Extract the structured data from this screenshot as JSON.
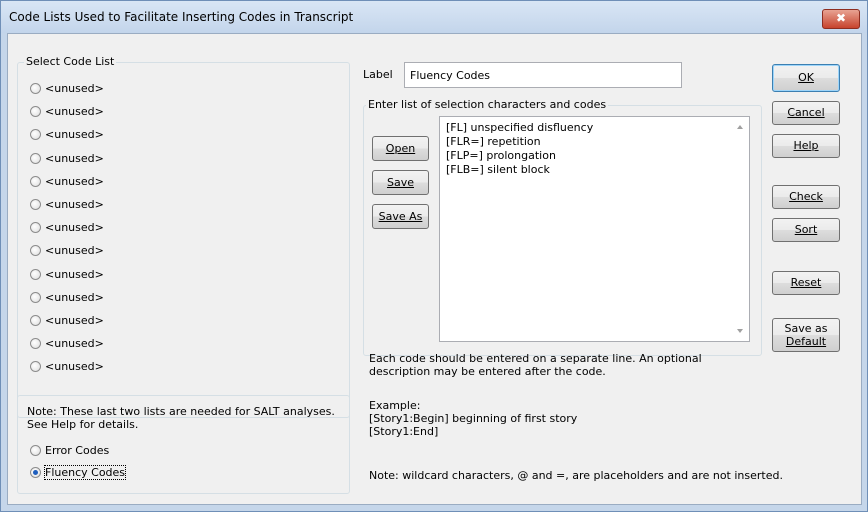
{
  "window": {
    "title": "Code Lists Used to Facilitate Inserting Codes in Transcript",
    "close_glyph": "✖"
  },
  "code_list": {
    "group_label": "Select Code List",
    "items": [
      "<unused>",
      "<unused>",
      "<unused>",
      "<unused>",
      "<unused>",
      "<unused>",
      "<unused>",
      "<unused>",
      "<unused>",
      "<unused>",
      "<unused>",
      "<unused>",
      "<unused>"
    ]
  },
  "salt": {
    "note": "Note: These last two lists are needed for SALT analyses.\nSee Help for details.",
    "error_codes": "Error Codes",
    "fluency_codes": "Fluency Codes",
    "selected": "Fluency Codes"
  },
  "label_field": {
    "label": "Label",
    "value": "Fluency Codes"
  },
  "codes_group": {
    "label": "Enter list of selection characters and codes",
    "content": "[FL] unspecified disfluency\n[FLR=] repetition\n[FLP=] prolongation\n[FLB=] silent block",
    "open": "Open",
    "save": "Save",
    "save_as": "Save As"
  },
  "help_text": {
    "instructions": "Each code should be entered on a separate line. An optional\ndescription may be entered after the code.",
    "example": "Example:\n[Story1:Begin] beginning of first story\n[Story1:End]",
    "wildcard_note": "Note: wildcard characters, @ and =, are placeholders and are not inserted."
  },
  "buttons": {
    "ok": "OK",
    "cancel": "Cancel",
    "help": "Help",
    "check": "Check",
    "sort": "Sort",
    "reset": "Reset",
    "save_default_1": "Save as",
    "save_default_2": "Default"
  }
}
